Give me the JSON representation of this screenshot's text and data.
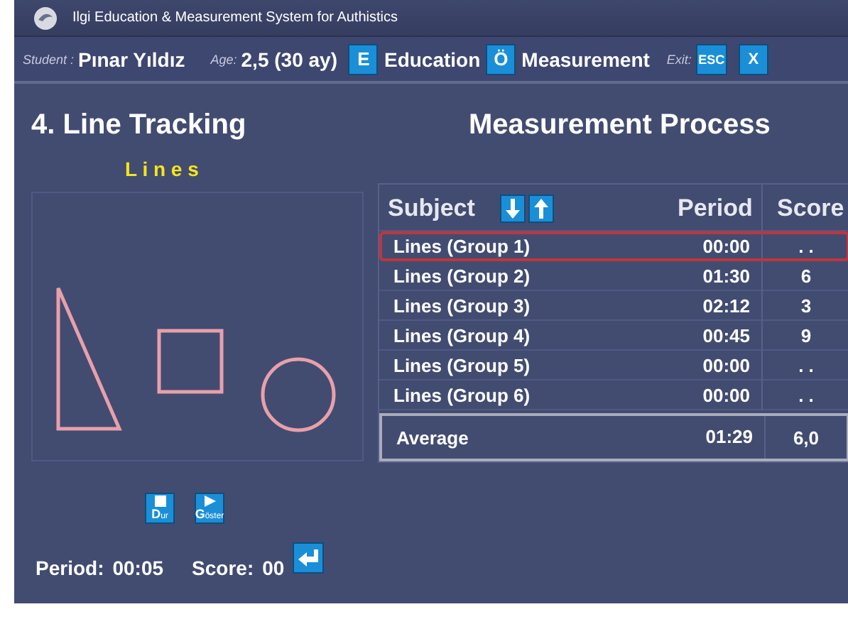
{
  "window": {
    "title": "Ilgi Education & Measurement System for Authistics"
  },
  "student_bar": {
    "student_label": "Student :",
    "student_name": "Pınar Yıldız",
    "age_label": "Age:",
    "age": "2,5  (30 ay)",
    "modes": [
      {
        "key": "E",
        "label": "Education"
      },
      {
        "key": "Ö",
        "label": "Measurement"
      }
    ],
    "exit_label": "Exit:",
    "exit_buttons": [
      "ESC",
      "X"
    ]
  },
  "activity": {
    "title": "4. Line Tracking",
    "subtitle": "L i n e s",
    "controls": [
      "Dur",
      "Göster"
    ],
    "period_label": "Period:",
    "period": "00:05",
    "score_label": "Score:",
    "score": "00"
  },
  "measurement": {
    "title": "Measurement Process",
    "table": {
      "columns": [
        "Subject",
        "Period",
        "Score"
      ],
      "rows": [
        {
          "subject": "Lines (Group 1)",
          "period": "00:00",
          "score": ". .",
          "selected": true
        },
        {
          "subject": "Lines (Group 2)",
          "period": "01:30",
          "score": "6",
          "selected": false
        },
        {
          "subject": "Lines (Group 3)",
          "period": "02:12",
          "score": "3",
          "selected": false
        },
        {
          "subject": "Lines (Group 4)",
          "period": "00:45",
          "score": "9",
          "selected": false
        },
        {
          "subject": "Lines (Group 5)",
          "period": "00:00",
          "score": ". .",
          "selected": false
        },
        {
          "subject": "Lines (Group 6)",
          "period": "00:00",
          "score": ". .",
          "selected": false
        }
      ],
      "average": {
        "label": "Average",
        "period": "01:29",
        "score": "6,0"
      }
    }
  }
}
